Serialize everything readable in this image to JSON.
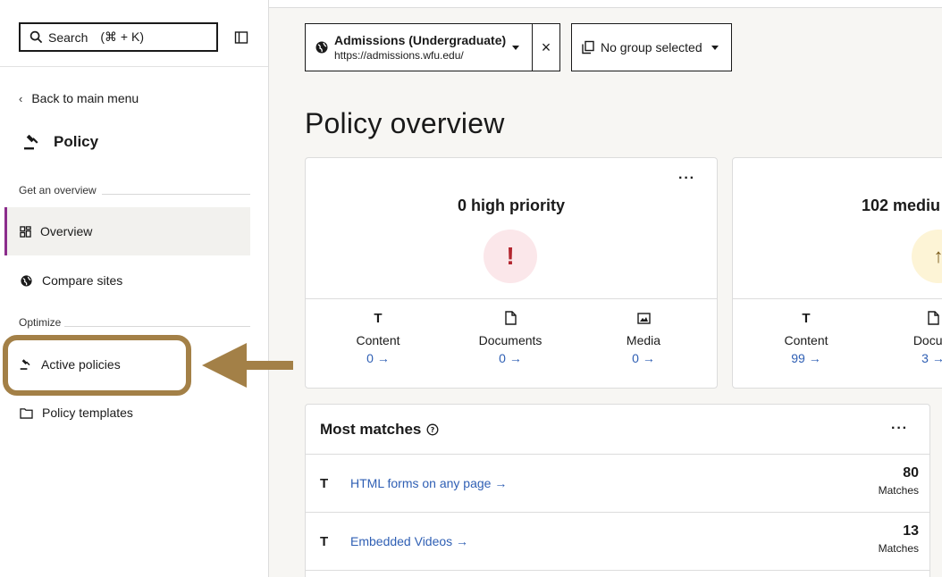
{
  "sidebar": {
    "search_label": "Search",
    "search_shortcut": "(⌘ + K)",
    "back_label": "Back to main menu",
    "section_title": "Policy",
    "group_overview": "Get an overview",
    "group_optimize": "Optimize",
    "items": [
      {
        "label": "Overview"
      },
      {
        "label": "Compare sites"
      },
      {
        "label": "Active policies"
      },
      {
        "label": "Policy templates"
      }
    ]
  },
  "header": {
    "site_name": "Admissions (Undergraduate)",
    "site_url": "https://admissions.wfu.edu/",
    "group_label": "No group selected"
  },
  "main": {
    "title": "Policy overview",
    "cards": [
      {
        "heading": "0 high priority",
        "symbol": "!",
        "stats": [
          {
            "label": "Content",
            "value": "0 →"
          },
          {
            "label": "Documents",
            "value": "0 →"
          },
          {
            "label": "Media",
            "value": "0 →"
          }
        ]
      },
      {
        "heading": "102 mediu",
        "symbol": "↑",
        "stats": [
          {
            "label": "Content",
            "value": "99 →"
          },
          {
            "label": "Docum",
            "value": "3 →"
          }
        ]
      }
    ],
    "matches": {
      "title": "Most matches",
      "rows": [
        {
          "label": "HTML forms on any page →",
          "count": "80",
          "count_label": "Matches"
        },
        {
          "label": "Embedded Videos →",
          "count": "13",
          "count_label": "Matches"
        }
      ]
    }
  },
  "colors": {
    "accent_active": "#8b2c8b",
    "link": "#2f5fb4",
    "annotation": "#a38047"
  }
}
